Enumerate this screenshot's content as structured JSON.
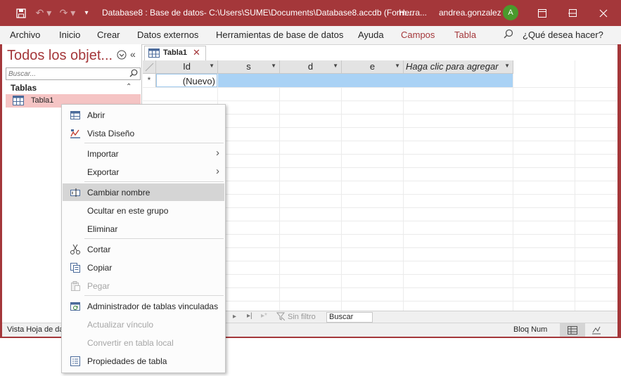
{
  "window": {
    "title": "Database8 : Base de datos- C:\\Users\\SUME\\Documents\\Database8.accdb (Form...",
    "context_label": "Herra...",
    "user": "andrea.gonzalez",
    "avatar_initial": "A",
    "accent_color": "#a4373a"
  },
  "ribbon": {
    "tabs": [
      "Archivo",
      "Inicio",
      "Crear",
      "Datos externos",
      "Herramientas de base de datos",
      "Ayuda",
      "Campos",
      "Tabla"
    ],
    "tell_me": "¿Qué desea hacer?"
  },
  "nav": {
    "title": "Todos los objet...",
    "search_placeholder": "Buscar...",
    "group": "Tablas",
    "item": "Tabla1"
  },
  "document": {
    "tab": "Tabla1",
    "columns": [
      "Id",
      "s",
      "d",
      "e",
      "Haga clic para agregar"
    ],
    "new_row_marker": "*",
    "new_row_value": "(Nuevo)"
  },
  "record_nav": {
    "filter_label": "Sin filtro",
    "search_label": "Buscar"
  },
  "status": {
    "left": "Vista Hoja de da",
    "caps": "Bloq Num"
  },
  "context_menu": {
    "items": [
      {
        "label": "Abrir",
        "icon": "open-table-icon",
        "disabled": false
      },
      {
        "label": "Vista Diseño",
        "icon": "design-view-icon",
        "disabled": false
      },
      {
        "label": "Importar",
        "icon": "",
        "disabled": false
      },
      {
        "label": "Exportar",
        "icon": "",
        "disabled": false
      },
      {
        "label": "Cambiar nombre",
        "icon": "rename-icon",
        "disabled": false
      },
      {
        "label": "Ocultar en este grupo",
        "icon": "",
        "disabled": false
      },
      {
        "label": "Eliminar",
        "icon": "",
        "disabled": false
      },
      {
        "label": "Cortar",
        "icon": "scissors-icon",
        "disabled": false
      },
      {
        "label": "Copiar",
        "icon": "copy-icon",
        "disabled": false
      },
      {
        "label": "Pegar",
        "icon": "paste-icon",
        "disabled": true
      },
      {
        "label": "Administrador de tablas vinculadas",
        "icon": "linked-table-manager-icon",
        "disabled": false
      },
      {
        "label": "Actualizar vínculo",
        "icon": "",
        "disabled": true
      },
      {
        "label": "Convertir en tabla local",
        "icon": "",
        "disabled": true
      },
      {
        "label": "Propiedades de tabla",
        "icon": "table-properties-icon",
        "disabled": false
      }
    ]
  }
}
